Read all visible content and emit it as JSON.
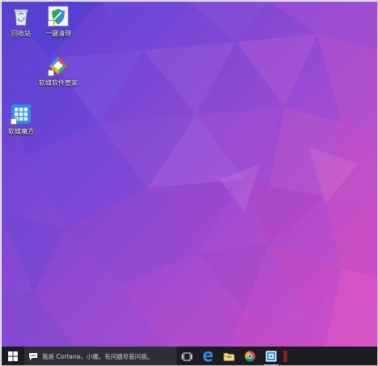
{
  "desktop": {
    "icons": [
      {
        "label": "回收站",
        "icon": "recycle-bin-icon"
      },
      {
        "label": "一键清理",
        "icon": "cleanup-shield-icon"
      },
      {
        "label": "软媒软件管家",
        "icon": "software-manager-icon"
      },
      {
        "label": "软媒魔方",
        "icon": "rubik-cube-app-icon"
      }
    ]
  },
  "taskbar": {
    "start_icon": "windows-logo-icon",
    "search_placeholder": "我是 Cortana，小娜。有问题尽管问我。",
    "pinned": [
      {
        "name": "task-view",
        "icon": "task-view-icon"
      },
      {
        "name": "edge",
        "icon": "edge-browser-icon"
      },
      {
        "name": "file-explorer",
        "icon": "folder-icon"
      },
      {
        "name": "chrome",
        "icon": "chrome-icon"
      },
      {
        "name": "store",
        "icon": "store-app-icon"
      }
    ]
  },
  "colors": {
    "taskbar": "#1b1b24",
    "search_box": "#2e2e38",
    "wallpaper_start": "#5a3fd0",
    "wallpaper_end": "#d24fc6"
  }
}
